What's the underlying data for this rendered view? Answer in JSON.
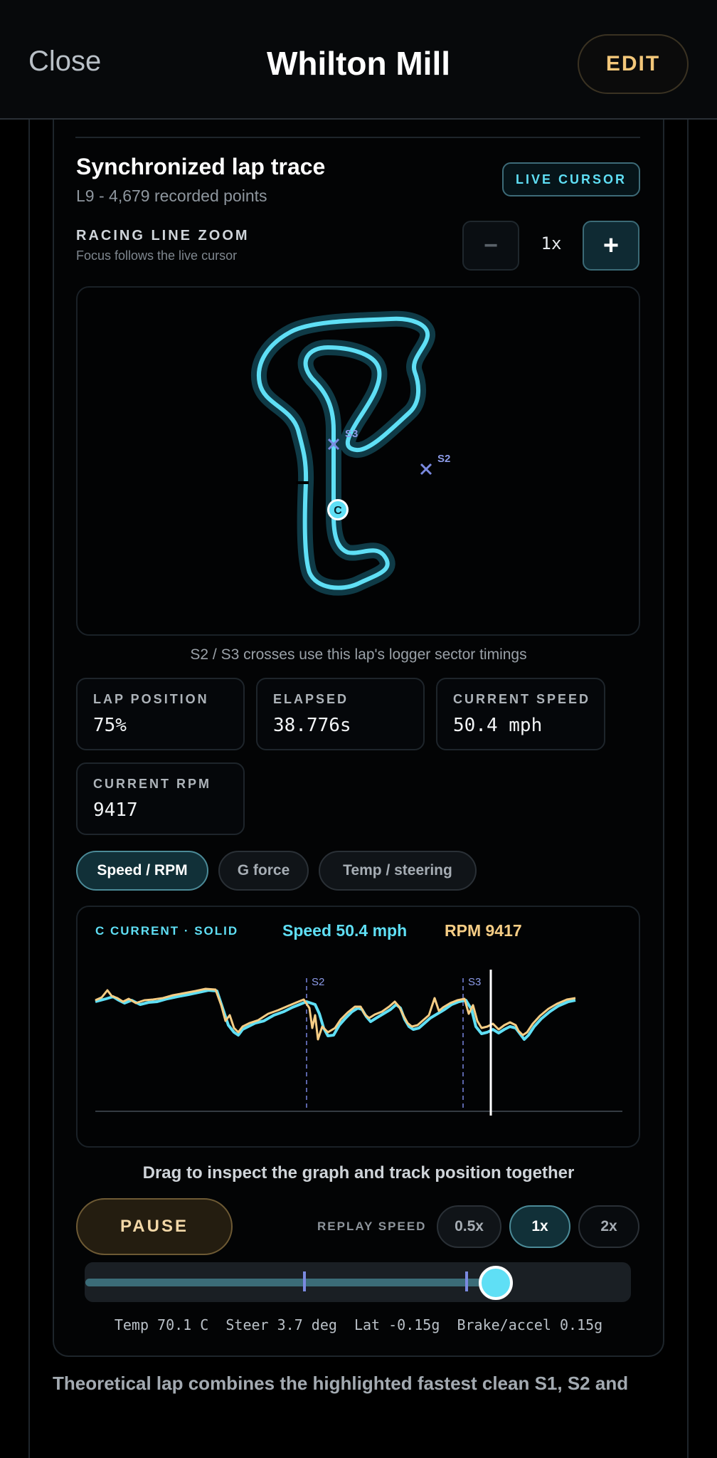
{
  "header": {
    "close_label": "Close",
    "title": "Whilton Mill",
    "edit_label": "EDIT"
  },
  "lap_trace": {
    "title": "Synchronized lap trace",
    "subtitle": "L9 - 4,679 recorded points",
    "live_badge": "LIVE CURSOR"
  },
  "zoom": {
    "title": "RACING LINE ZOOM",
    "subtitle": "Focus follows the live cursor",
    "minus_label": "−",
    "value": "1x",
    "plus_label": "+"
  },
  "map": {
    "sector_labels": [
      "S3",
      "S2"
    ],
    "cursor_label": "C",
    "note": "S2 / S3 crosses use this lap's logger sector timings"
  },
  "stats": [
    {
      "label": "LAP POSITION",
      "value": "75%"
    },
    {
      "label": "ELAPSED",
      "value": "38.776s"
    },
    {
      "label": "CURRENT SPEED",
      "value": "50.4 mph"
    },
    {
      "label": "CURRENT RPM",
      "value": "9417"
    }
  ],
  "graph_tabs": [
    "Speed / RPM",
    "G force",
    "Temp / steering"
  ],
  "graph": {
    "current_label": "C CURRENT · SOLID",
    "speed_readout": "Speed 50.4 mph",
    "rpm_readout": "RPM 9417",
    "sector_labels": [
      "S2",
      "S3"
    ]
  },
  "drag_note": "Drag to inspect the graph and track position together",
  "playback": {
    "pause_label": "PAUSE",
    "replay_speed_label": "REPLAY SPEED",
    "speed_options": [
      "0.5x",
      "1x",
      "2x"
    ],
    "selected_speed": "1x",
    "progress": 0.75
  },
  "telemetry": "Temp 70.1 C  Steer 3.7 deg  Lat -0.15g  Brake/accel 0.15g",
  "footer_text": "Theoretical lap combines the highlighted fastest clean S1, S2 and",
  "colors": {
    "accent_cyan": "#5fdff5",
    "accent_amber": "#f6cd85",
    "sector_marker": "#7a8ae0"
  }
}
